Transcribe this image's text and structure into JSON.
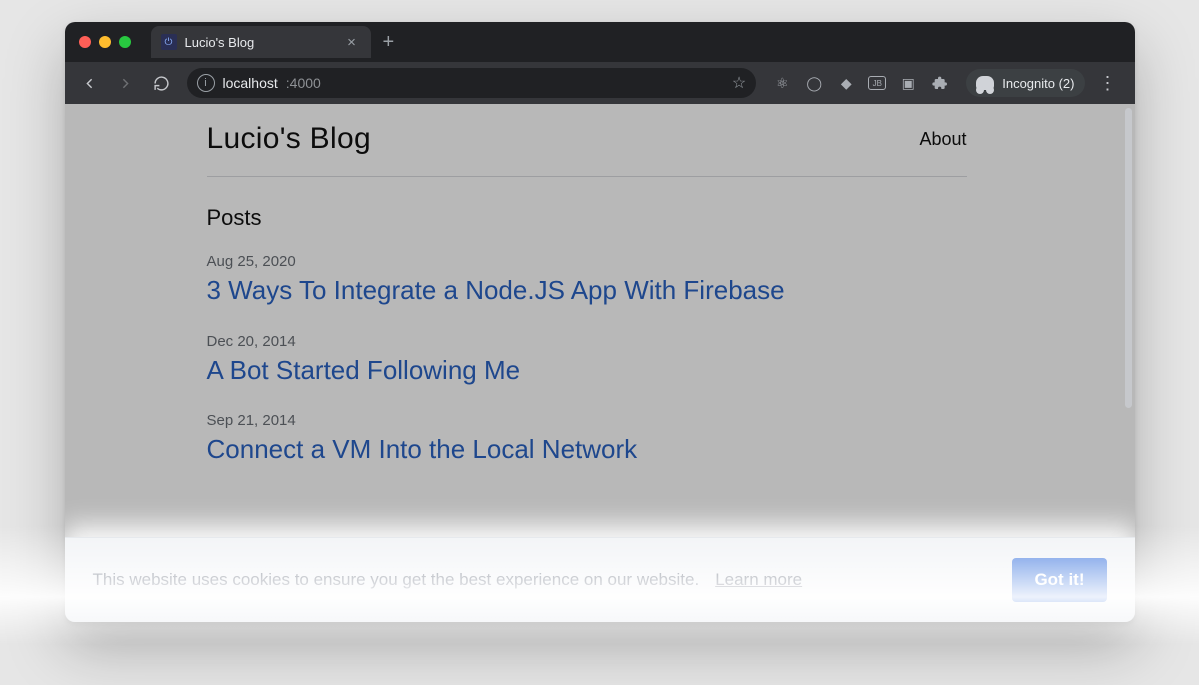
{
  "browser": {
    "tab": {
      "title": "Lucio's Blog"
    },
    "url": {
      "host": "localhost",
      "port": ":4000"
    },
    "incognito_label": "Incognito (2)"
  },
  "site": {
    "title": "Lucio's Blog",
    "nav": {
      "about": "About"
    }
  },
  "content": {
    "heading": "Posts",
    "posts": [
      {
        "date": "Aug 25, 2020",
        "title": "3 Ways To Integrate a Node.JS App With Firebase"
      },
      {
        "date": "Dec 20, 2014",
        "title": "A Bot Started Following Me"
      },
      {
        "date": "Sep 21, 2014",
        "title": "Connect a VM Into the Local Network"
      }
    ]
  },
  "cookie": {
    "text": "This website uses cookies to ensure you get the best experience on our website.",
    "learn": "Learn more",
    "button": "Got it!"
  }
}
